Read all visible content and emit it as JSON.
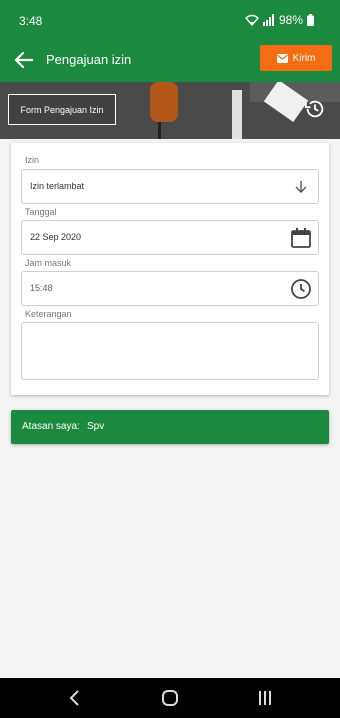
{
  "status": {
    "time": "3:48",
    "battery": "98%"
  },
  "appbar": {
    "title": "Pengajuan izin",
    "send_label": "Kirim"
  },
  "banner": {
    "label": "Form Pengajuan Izin"
  },
  "form": {
    "izin": {
      "label": "Izin",
      "value": "Izin terlambat"
    },
    "tanggal": {
      "label": "Tanggal",
      "value": "22 Sep 2020"
    },
    "jam_masuk": {
      "label": "Jam masuk",
      "value": "15:48"
    },
    "keterangan": {
      "label": "Keterangan",
      "value": ""
    }
  },
  "atasan": {
    "label": "Atasan saya:",
    "value": "Spv"
  },
  "colors": {
    "primary": "#1c8a3e",
    "accent": "#f46d12"
  },
  "icons": [
    "wifi-icon",
    "signal-icon",
    "battery-icon",
    "back-arrow-icon",
    "mail-icon",
    "history-icon",
    "arrow-down-icon",
    "calendar-icon",
    "clock-icon",
    "nav-back-icon",
    "nav-home-icon",
    "nav-recents-icon"
  ]
}
